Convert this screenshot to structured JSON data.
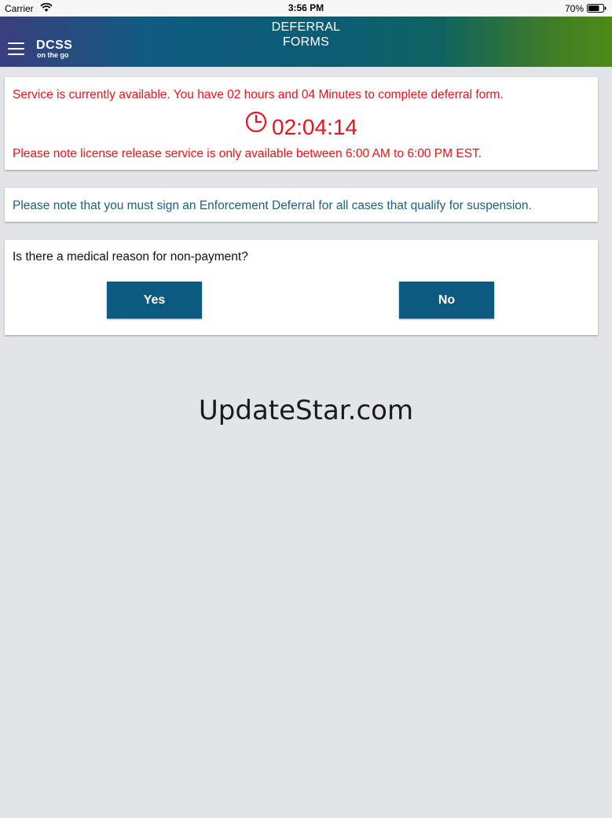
{
  "status_bar": {
    "carrier": "Carrier",
    "time": "3:56 PM",
    "battery": "70%",
    "icons": [
      "wifi-icon",
      "battery-icon"
    ]
  },
  "header": {
    "logo_main": "DCSS",
    "logo_sub": "on the go",
    "title_line1": "DEFERRAL",
    "title_line2": "FORMS",
    "menu_icon": "hamburger-menu-icon"
  },
  "timer_card": {
    "availability": "Service is currently available. You have 02 hours and 04 Minutes to complete deferral form.",
    "timer": "02:04:14",
    "hours_note": "Please note license release service is only available between 6:00 AM to 6:00 PM EST.",
    "icon": "clock-icon"
  },
  "notice_card": {
    "text": "Please note that you must sign an Enforcement Deferral for all cases that qualify for suspension."
  },
  "question_card": {
    "question": "Is there a medical reason for non-payment?",
    "yes_label": "Yes",
    "no_label": "No"
  },
  "watermark": "UpdateStar.com",
  "colors": {
    "alert_red": "#e8141b",
    "notice_blue": "#1a5f85",
    "button_blue": "#0d5a80",
    "background": "#e2e5e7"
  }
}
